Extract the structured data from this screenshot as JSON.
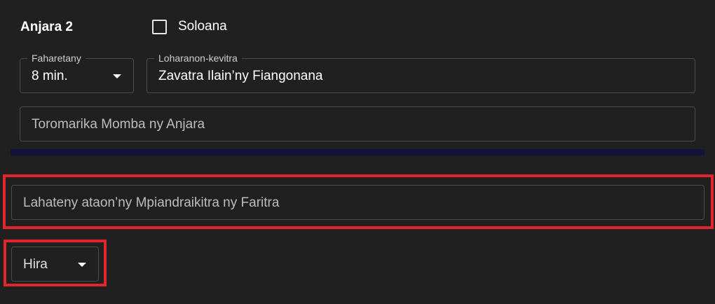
{
  "part": {
    "title": "Anjara 2"
  },
  "solo_checkbox": {
    "label": "Soloana",
    "checked": false
  },
  "duration_select": {
    "legend": "Faharetany",
    "value": "8 min."
  },
  "source_field": {
    "legend": "Loharanon-kevitra",
    "value": "Zavatra Ilain’ny Fiangonana"
  },
  "part_theme_field": {
    "placeholder": "Toromarika Momba ny Anjara"
  },
  "study_point_field": {
    "placeholder": "Lahateny ataon’ny Mpiandraikitra ny Faritra"
  },
  "song_select": {
    "value": "Hira"
  },
  "colors": {
    "background": "#202020",
    "divider": "#14143a",
    "highlight": "#e3262b",
    "field_border": "#4c4c4c"
  },
  "icons": {
    "dropdown": "caret-down-icon",
    "checkbox": "checkbox-unchecked-icon"
  }
}
